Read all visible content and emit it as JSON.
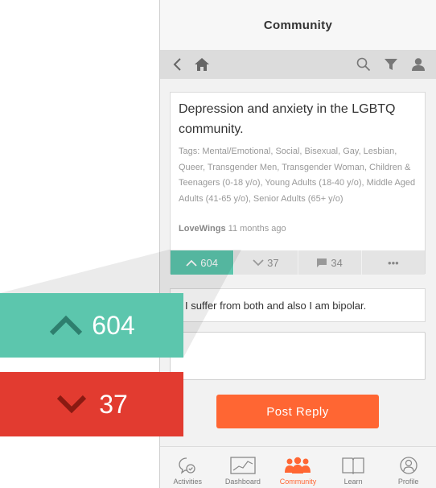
{
  "header": {
    "title": "Community"
  },
  "post": {
    "title": "Depression and anxiety in the LGBTQ community.",
    "tags": "Tags: Mental/Emotional, Social, Bisexual, Gay, Lesbian, Queer, Transgender Men, Transgender Woman, Children & Teenagers (0-18 y/o), Young Adults (18-40 y/o), Middle Aged Adults (41-65 y/o), Senior Adults (65+ y/o)",
    "author": "LoveWings",
    "time": "11 months ago",
    "upvotes": "604",
    "downvotes": "37",
    "comments": "34",
    "more": "•••"
  },
  "reply": {
    "text": "I suffer from both and also I am bipolar.",
    "button_label": "Post Reply"
  },
  "tabs": [
    {
      "label": "Activities",
      "icon": "activities-icon"
    },
    {
      "label": "Dashboard",
      "icon": "dashboard-icon"
    },
    {
      "label": "Community",
      "icon": "community-icon"
    },
    {
      "label": "Learn",
      "icon": "learn-icon"
    },
    {
      "label": "Profile",
      "icon": "profile-icon"
    }
  ],
  "active_tab": "Community",
  "callouts": {
    "upvote_value": "604",
    "downvote_value": "37"
  },
  "colors": {
    "accent_orange": "#ff6633",
    "upvote_teal": "#5cc6ad",
    "downvote_red": "#e23b30",
    "chevron_dark_teal": "#2e7f6e",
    "chevron_dark_red": "#8a1a12"
  }
}
